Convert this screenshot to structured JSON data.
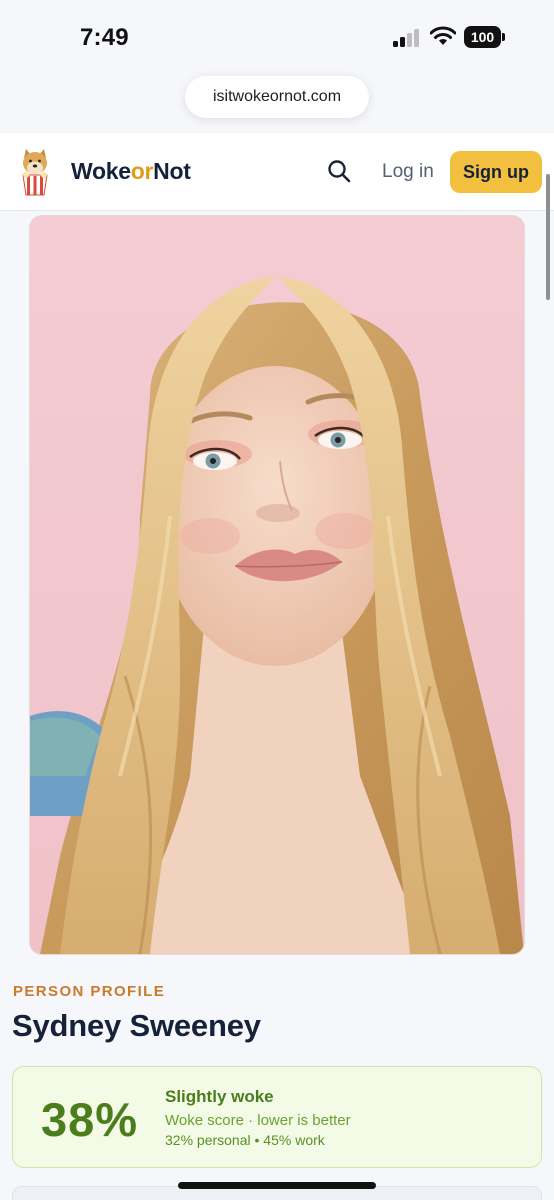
{
  "status_bar": {
    "time": "7:49",
    "battery": "100"
  },
  "browser": {
    "url": "isitwokeornot.com"
  },
  "header": {
    "brand_prefix": "Woke",
    "brand_accent": "or",
    "brand_suffix": "Not",
    "login_label": "Log in",
    "signup_label": "Sign up",
    "accent_color": "#f3bf3f"
  },
  "profile": {
    "eyebrow": "PERSON PROFILE",
    "name": "Sydney Sweeney"
  },
  "score": {
    "value": "38%",
    "label": "Slightly woke",
    "hint": "Woke score · lower is better",
    "breakdown": "32% personal • 45% work",
    "color": "#4b7d1d"
  }
}
